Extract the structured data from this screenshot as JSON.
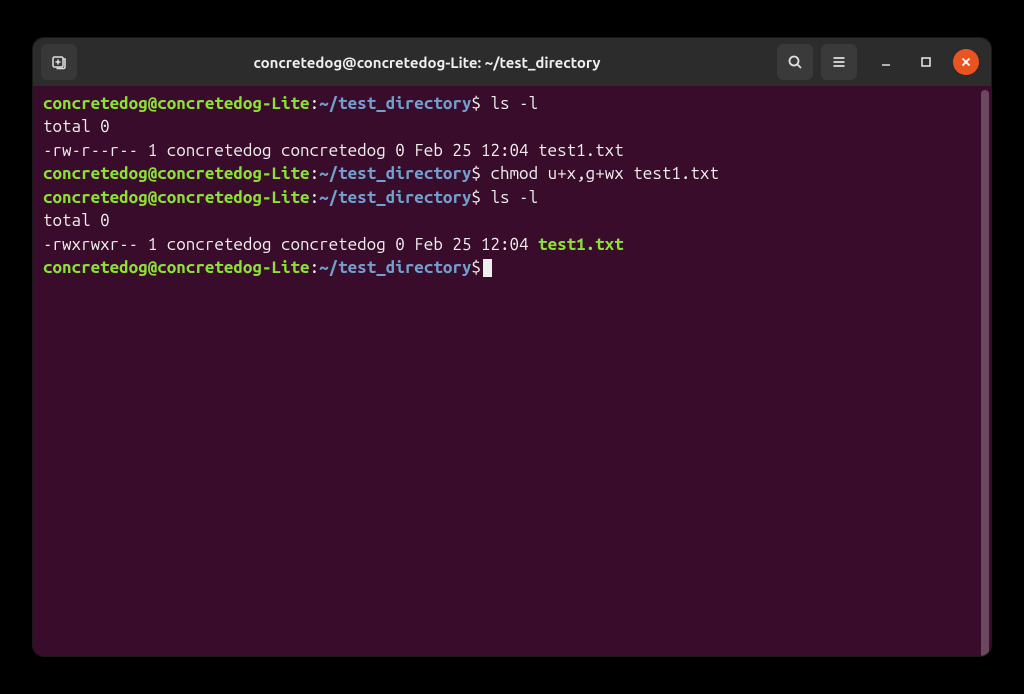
{
  "title": "concretedog@concretedog-Lite: ~/test_directory",
  "prompt": {
    "user_host": "concretedog@concretedog-Lite",
    "path": "~/test_directory",
    "symbol": "$"
  },
  "lines": {
    "cmd1": "ls -l",
    "out1": "total 0",
    "out2": "-rw-r--r-- 1 concretedog concretedog 0 Feb 25 12:04 test1.txt",
    "cmd2": "chmod u+x,g+wx test1.txt",
    "cmd3": "ls -l",
    "out3": "total 0",
    "out4_perm": "-rwxrwxr-- 1 concretedog concretedog 0 Feb 25 12:04 ",
    "out4_file": "test1.txt"
  }
}
